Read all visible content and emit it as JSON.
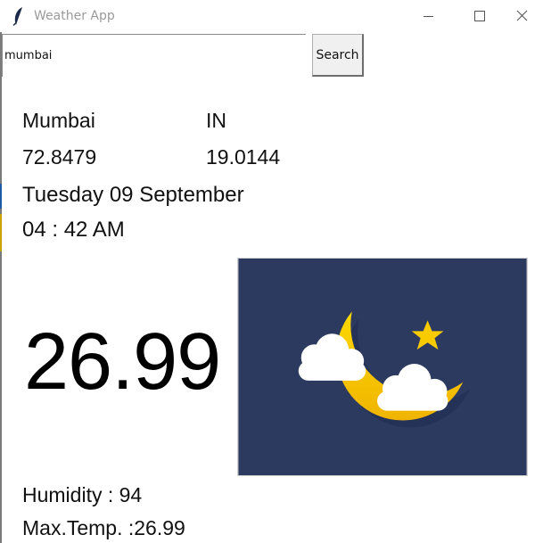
{
  "window": {
    "title": "Weather App",
    "app_icon": "feather-icon",
    "controls": [
      "minimize-icon",
      "maximize-icon",
      "close-icon"
    ]
  },
  "search": {
    "value": "mumbai",
    "button_label": "Search"
  },
  "location": {
    "city": "Mumbai",
    "country": "IN",
    "longitude": "72.8479",
    "latitude": "19.0144"
  },
  "datetime": {
    "date": "Tuesday  09 September",
    "time": "04 : 42 AM"
  },
  "weather": {
    "temperature": "26.99",
    "humidity": "Humidity : 94",
    "max_temp": "Max.Temp. :26.99",
    "icon": "night-crescent-moon-clouds-icon"
  },
  "colors": {
    "icon_background": "#2c3a60",
    "moon": "#f6c500",
    "star": "#f8cb00",
    "cloud": "#ffffff"
  }
}
